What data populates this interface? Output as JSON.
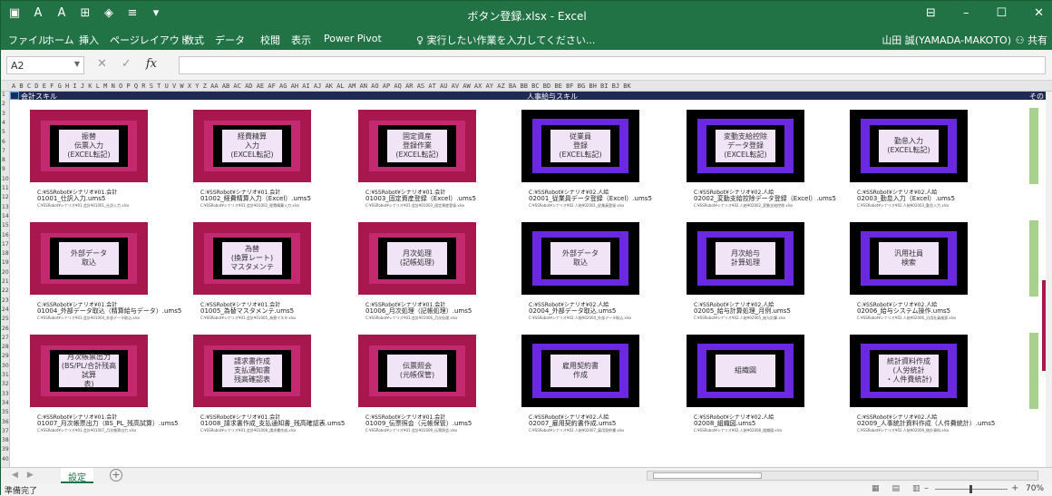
{
  "window": {
    "title": "ボタン登録.xlsx - Excel",
    "user": "山田 誠(YAMADA-MAKOTO)",
    "share": "共有"
  },
  "ribbon": {
    "tabs": [
      "ファイル",
      "ホーム",
      "挿入",
      "ページレイアウト",
      "数式",
      "データ",
      "校閲",
      "表示",
      "Power Pivot"
    ],
    "tell_me": "実行したい作業を入力してください..."
  },
  "formula_bar": {
    "name_box": "A2",
    "cancel": "✕",
    "enter": "✓",
    "fx": "fx",
    "value": ""
  },
  "column_headers": "A B C D      E          F G H I J K L M N        O              P Q R S T U V W X         Y            Z AA AB AC AD AE AF AG AH           AI            AJ AK AL AM AN AO AP AQ AR        AS          AT AU AV AW AX AY AZ BA BB         BC             BD BE BF BG BH BI BJ BK",
  "row_numbers": [
    "1",
    "2",
    "3",
    "4",
    "5",
    "6",
    "7",
    "8",
    "9",
    "10",
    "11",
    "12",
    "13",
    "14",
    "15",
    "16",
    "17",
    "18",
    "19",
    "20",
    "21",
    "22",
    "23",
    "24",
    "25",
    "26",
    "27",
    "28",
    "29",
    "30",
    "31",
    "32",
    "33",
    "34",
    "35",
    "36",
    "37",
    "38",
    "39",
    "40"
  ],
  "sections": {
    "accounting": "会計スキル",
    "hr": "人事給与スキル",
    "other": "その"
  },
  "buttons": [
    {
      "label": "振替\n伝票入力\n(EXCEL転記)",
      "kind": "acct"
    },
    {
      "label": "経費精算\n入力\n(EXCEL転記)",
      "kind": "acct"
    },
    {
      "label": "固定資産\n登録作業\n(EXCEL転記)",
      "kind": "acct"
    },
    {
      "label": "従業員\n登録\n(EXCEL転記)",
      "kind": "hr"
    },
    {
      "label": "変動支給控除\nデータ登録\n(EXCEL転記)",
      "kind": "hr"
    },
    {
      "label": "勤怠入力\n(EXCEL転記)",
      "kind": "hr"
    },
    {
      "label": "外部データ\n取込",
      "kind": "acct"
    },
    {
      "label": "為替\n(換算レート)\nマスタメンテ",
      "kind": "acct"
    },
    {
      "label": "月次処理\n(記帳処理)",
      "kind": "acct"
    },
    {
      "label": "外部データ\n取込",
      "kind": "hr"
    },
    {
      "label": "月次給与\n計算処理",
      "kind": "hr"
    },
    {
      "label": "汎用社員\n検索",
      "kind": "hr"
    },
    {
      "label": "月次帳票出力\n(BS/PL/合計残高試算\n表)",
      "kind": "acct"
    },
    {
      "label": "請求書作成\n支払通知書\n残高確認表",
      "kind": "acct"
    },
    {
      "label": "伝票照会\n(元帳保管)",
      "kind": "acct"
    },
    {
      "label": "雇用契約書\n作成",
      "kind": "hr"
    },
    {
      "label": "組織図",
      "kind": "hr"
    },
    {
      "label": "統計資料作成\n(人労統計\n・人件費統計)",
      "kind": "hr"
    }
  ],
  "paths": [
    {
      "dir": "C:¥SSRobot¥シナリオ¥01.会計",
      "file": "01001_仕訳入力.ums5",
      "note": "C:¥SSRobot¥シナリオ¥01.会計¥01001_仕訳入力.xlsx"
    },
    {
      "dir": "C:¥SSRobot¥シナリオ¥01.会計",
      "file": "01002_経費精算入力（Excel）.ums5",
      "note": "C:¥SSRobot¥シナリオ¥01.会計¥01002_経費精算入力.xlsx"
    },
    {
      "dir": "C:¥SSRobot¥シナリオ¥01.会計",
      "file": "01003_固定資産登録（Excel）.ums5",
      "note": "C:¥SSRobot¥シナリオ¥01.会計¥01003_固定資産登録.xlsx"
    },
    {
      "dir": "C:¥SSRobot¥シナリオ¥02.人給",
      "file": "02001_従業員データ登録（Excel）.ums5",
      "note": "C:¥SSRobot¥シナリオ¥02.人給¥02001_従業員登録.xlsx"
    },
    {
      "dir": "C:¥SSRobot¥シナリオ¥02.人給",
      "file": "02002_変動支給控除データ登録（Excel）.ums5",
      "note": "C:¥SSRobot¥シナリオ¥02.人給¥02002_変動支給控除.xlsx"
    },
    {
      "dir": "C:¥SSRobot¥シナリオ¥02.人給",
      "file": "02003_勤怠入力（Excel）.ums5",
      "note": "C:¥SSRobot¥シナリオ¥02.人給¥02003_勤怠入力.xlsx"
    },
    {
      "dir": "C:¥SSRobot¥シナリオ¥01.会計",
      "file": "01004_外部データ取込（精算給与データ）.ums5",
      "note": "C:¥SSRobot¥シナリオ¥01.会計¥01004_外部データ取込.xlsx"
    },
    {
      "dir": "C:¥SSRobot¥シナリオ¥01.会計",
      "file": "01005_為替マスタメンテ.ums5",
      "note": "C:¥SSRobot¥シナリオ¥01.会計¥01005_為替マスタ.xlsx"
    },
    {
      "dir": "C:¥SSRobot¥シナリオ¥01.会計",
      "file": "01006_月次処理（記帳処理）.ums5",
      "note": "C:¥SSRobot¥シナリオ¥01.会計¥01006_月次処理.xlsx"
    },
    {
      "dir": "C:¥SSRobot¥シナリオ¥02.人給",
      "file": "02004_外部データ取込.ums5",
      "note": "C:¥SSRobot¥シナリオ¥02.人給¥02004_外部データ取込.xlsx"
    },
    {
      "dir": "C:¥SSRobot¥シナリオ¥02.人給",
      "file": "02005_給与計算処理_月例.ums5",
      "note": "C:¥SSRobot¥シナリオ¥02.人給¥02005_給与計算.xlsx"
    },
    {
      "dir": "C:¥SSRobot¥シナリオ¥02.人給",
      "file": "02006_給与システム操作.ums5",
      "note": "C:¥SSRobot¥シナリオ¥02.人給¥02006_汎用社員検索.xlsx"
    },
    {
      "dir": "C:¥SSRobot¥シナリオ¥01.会計",
      "file": "01007_月次帳票出力（BS_PL_残高試算）.ums5",
      "note": "C:¥SSRobot¥シナリオ¥01.会計¥01007_月次帳票出力.xlsx"
    },
    {
      "dir": "C:¥SSRobot¥シナリオ¥01.会計",
      "file": "01008_請求書作成_支払通知書_残高確認表.ums5",
      "note": "C:¥SSRobot¥シナリオ¥01.会計¥01008_請求書作成.xlsx"
    },
    {
      "dir": "C:¥SSRobot¥シナリオ¥01.会計",
      "file": "01009_伝票照会（元帳保管）.ums5",
      "note": "C:¥SSRobot¥シナリオ¥01.会計¥01009_伝票照会.xlsx"
    },
    {
      "dir": "C:¥SSRobot¥シナリオ¥02.人給",
      "file": "02007_雇用契約書作成.ums5",
      "note": "C:¥SSRobot¥シナリオ¥02.人給¥02007_雇用契約書.xlsx"
    },
    {
      "dir": "C:¥SSRobot¥シナリオ¥02.人給",
      "file": "02008_組織図.ums5",
      "note": "C:¥SSRobot¥シナリオ¥02.人給¥02008_組織図.xlsx"
    },
    {
      "dir": "C:¥SSRobot¥シナリオ¥02.人給",
      "file": "02009_人事統計資料作成（人件費統計）.ums5",
      "note": "C:¥SSRobot¥シナリオ¥02.人給¥02009_統計資料.xlsx"
    }
  ],
  "sheet_tabs": [
    "設定"
  ],
  "status": {
    "text": "準備完了",
    "zoom": "70%"
  },
  "colors": {
    "excel_green": "#217346",
    "accounting_outer": "#a8174e",
    "accounting_ring": "#c3296f",
    "hr_ring": "#6a28e0",
    "section_bar": "#1f2a54"
  }
}
